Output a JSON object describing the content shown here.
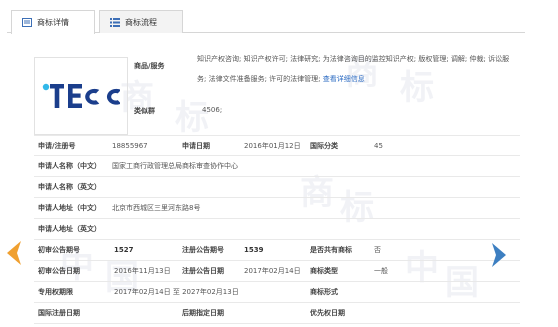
{
  "tabs": [
    {
      "label": "商标详情",
      "active": true,
      "icon": "document-icon"
    },
    {
      "label": "商标流程",
      "active": false,
      "icon": "list-icon"
    }
  ],
  "logo": {
    "text": "TECC",
    "colors": {
      "primary": "#1b3e8c",
      "accent": "#31b8e9"
    }
  },
  "goods": {
    "label": "商品/服务",
    "text": "知识产权咨询; 知识产权许可; 法律研究; 为法律咨询目的监控知识产权; 版权管理; 调解; 仲裁; 诉讼服务; 法律文件准备服务; 许可的法律管理;",
    "link": "查看详细信息"
  },
  "similar": {
    "label": "类似群",
    "value": "4506;"
  },
  "fields": {
    "reg_no_label": "申请/注册号",
    "reg_no": "18855967",
    "app_date_label": "申请日期",
    "app_date": "2016年01月12日",
    "intl_class_label": "国际分类",
    "intl_class": "45",
    "applicant_cn_label": "申请人名称（中文）",
    "applicant_cn": "国家工商行政管理总局商标审查协作中心",
    "applicant_en_label": "申请人名称（英文）",
    "applicant_en": "",
    "address_cn_label": "申请人地址（中文）",
    "address_cn": "北京市西城区三里河东路8号",
    "address_en_label": "申请人地址（英文）",
    "address_en": "",
    "prelim_no_label": "初审公告期号",
    "prelim_no": "1527",
    "reg_pub_no_label": "注册公告期号",
    "reg_pub_no": "1539",
    "shared_label": "是否共有商标",
    "shared": "否",
    "prelim_date_label": "初审公告日期",
    "prelim_date": "2016年11月13日",
    "reg_pub_date_label": "注册公告日期",
    "reg_pub_date": "2017年02月14日",
    "tm_type_label": "商标类型",
    "tm_type": "一般",
    "exclusive_label": "专用权期限",
    "exclusive": "2017年02月14日 至 2027年02月13日",
    "tm_form_label": "商标形式",
    "tm_form": "",
    "intl_reg_date_label": "国际注册日期",
    "intl_reg_date": "",
    "later_date_label": "后期指定日期",
    "later_date": "",
    "priority_date_label": "优先权日期",
    "priority_date": ""
  },
  "watermark": [
    "商",
    "标",
    "商",
    "标",
    "中",
    "国",
    "中",
    "国",
    "商",
    "标"
  ],
  "colors": {
    "arrow_left": "#f0a030",
    "arrow_right": "#3d7fc1",
    "link": "#2a6ac2",
    "logo_blue": "#1b3e8c"
  }
}
